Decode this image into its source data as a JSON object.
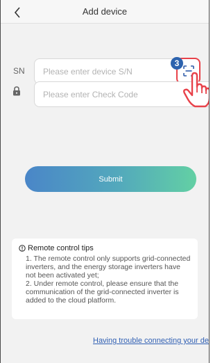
{
  "header": {
    "title": "Add device"
  },
  "sn_row": {
    "label": "SN",
    "placeholder": "Please enter device S/N",
    "value": ""
  },
  "code_row": {
    "placeholder": "Please enter Check Code",
    "value": ""
  },
  "annotation": {
    "step_number": "3"
  },
  "submit": {
    "label": "Submit"
  },
  "tips": {
    "title": "Remote control tips",
    "body": "1. The remote control only supports grid-connected inverters, and the energy storage inverters have not been activated yet;\n2. Under remote control, please ensure that the communication of the grid-connected inverter is added to the cloud platform."
  },
  "help": {
    "link_text": "Having trouble connecting your device?"
  },
  "colors": {
    "accent_red": "#e8424a",
    "badge_blue": "#2d63ae",
    "link_blue": "#2f5fb3"
  }
}
